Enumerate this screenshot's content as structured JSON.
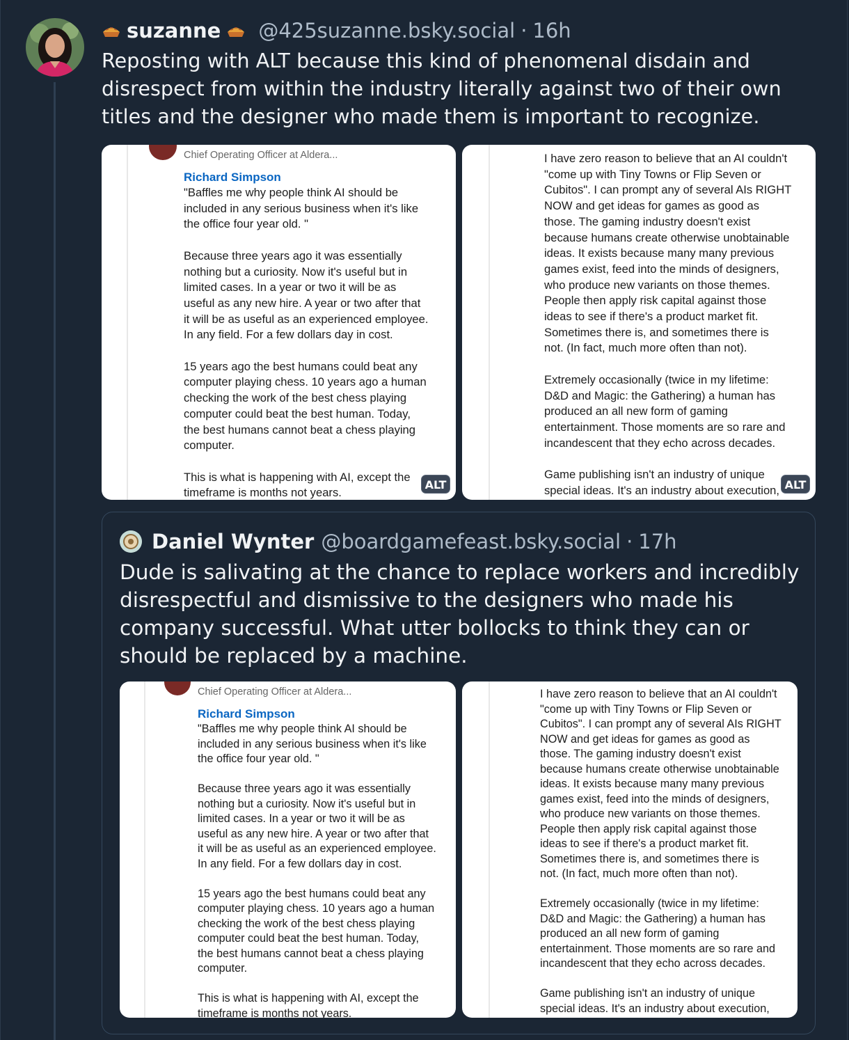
{
  "post": {
    "display_name": "suzanne",
    "handle": "@425suzanne.bsky.social",
    "time": "16h",
    "text": "Reposting with ALT because this kind of phenomenal disdain and disrespect from within the industry literally against two of their own titles and the designer who made them is important to recognize."
  },
  "quote": {
    "display_name": "Daniel Wynter",
    "handle": "@boardgamefeast.bsky.social",
    "time": "17h",
    "text": "Dude is salivating at the chance to replace workers and incredibly disrespectful and dismissive to the designers who made his company successful. What utter bollocks to think they can or should be replaced by a machine."
  },
  "screenshot_left": {
    "role": "Chief Operating Officer at Aldera...",
    "author": "Richard Simpson",
    "paragraphs": [
      "\"Baffles me why people think AI should be\nincluded in any serious business when it's like\nthe office four year old. \"",
      "Because three years ago it was essentially\nnothing but a curiosity. Now it's useful but in\nlimited cases. In a year or two it will be as\nuseful as any new hire. A year or two after that\nit will be as useful as an experienced employee.\nIn any field. For a few dollars day in cost.",
      "15 years ago the best humans could beat any\ncomputer playing chess. 10 years ago a human\nchecking the work of the best chess playing\ncomputer could beat the best human. Today,\nthe best humans cannot beat a chess playing\ncomputer.",
      "This is what is happening with AI, except the\ntimeframe is months not years."
    ]
  },
  "screenshot_right": {
    "paragraphs": [
      "I have zero reason to believe that an AI couldn't\n\"come up with Tiny Towns or Flip Seven or\nCubitos\". I can prompt any of several AIs RIGHT\nNOW and get ideas for games as good as\nthose. The gaming industry doesn't exist\nbecause humans create otherwise unobtainable\nideas. It exists because many many previous\ngames exist, feed into the minds of designers,\nwho produce new variants on those themes.\nPeople then apply risk capital against those\nideas to see if there's a product market fit.\nSometimes there is, and sometimes there is\nnot. (In fact, much more often than not).",
      "Extremely occasionally (twice in my lifetime:\nD&D and Magic: the Gathering) a human has\nproduced an all new form of gaming\nentertainment. Those moments are so rare and\nincandescent that they echo across decades.",
      "Game publishing isn't an industry of unique\nspecial ideas. It's an industry about execution,"
    ]
  },
  "alt_label": "ALT",
  "icons": {
    "pie": "pie-emoji-icon"
  },
  "colors": {
    "background": "#1b2634",
    "text": "#f1f3f5",
    "handle": "#aebbc9",
    "linkedin_blue": "#0a66c2"
  }
}
